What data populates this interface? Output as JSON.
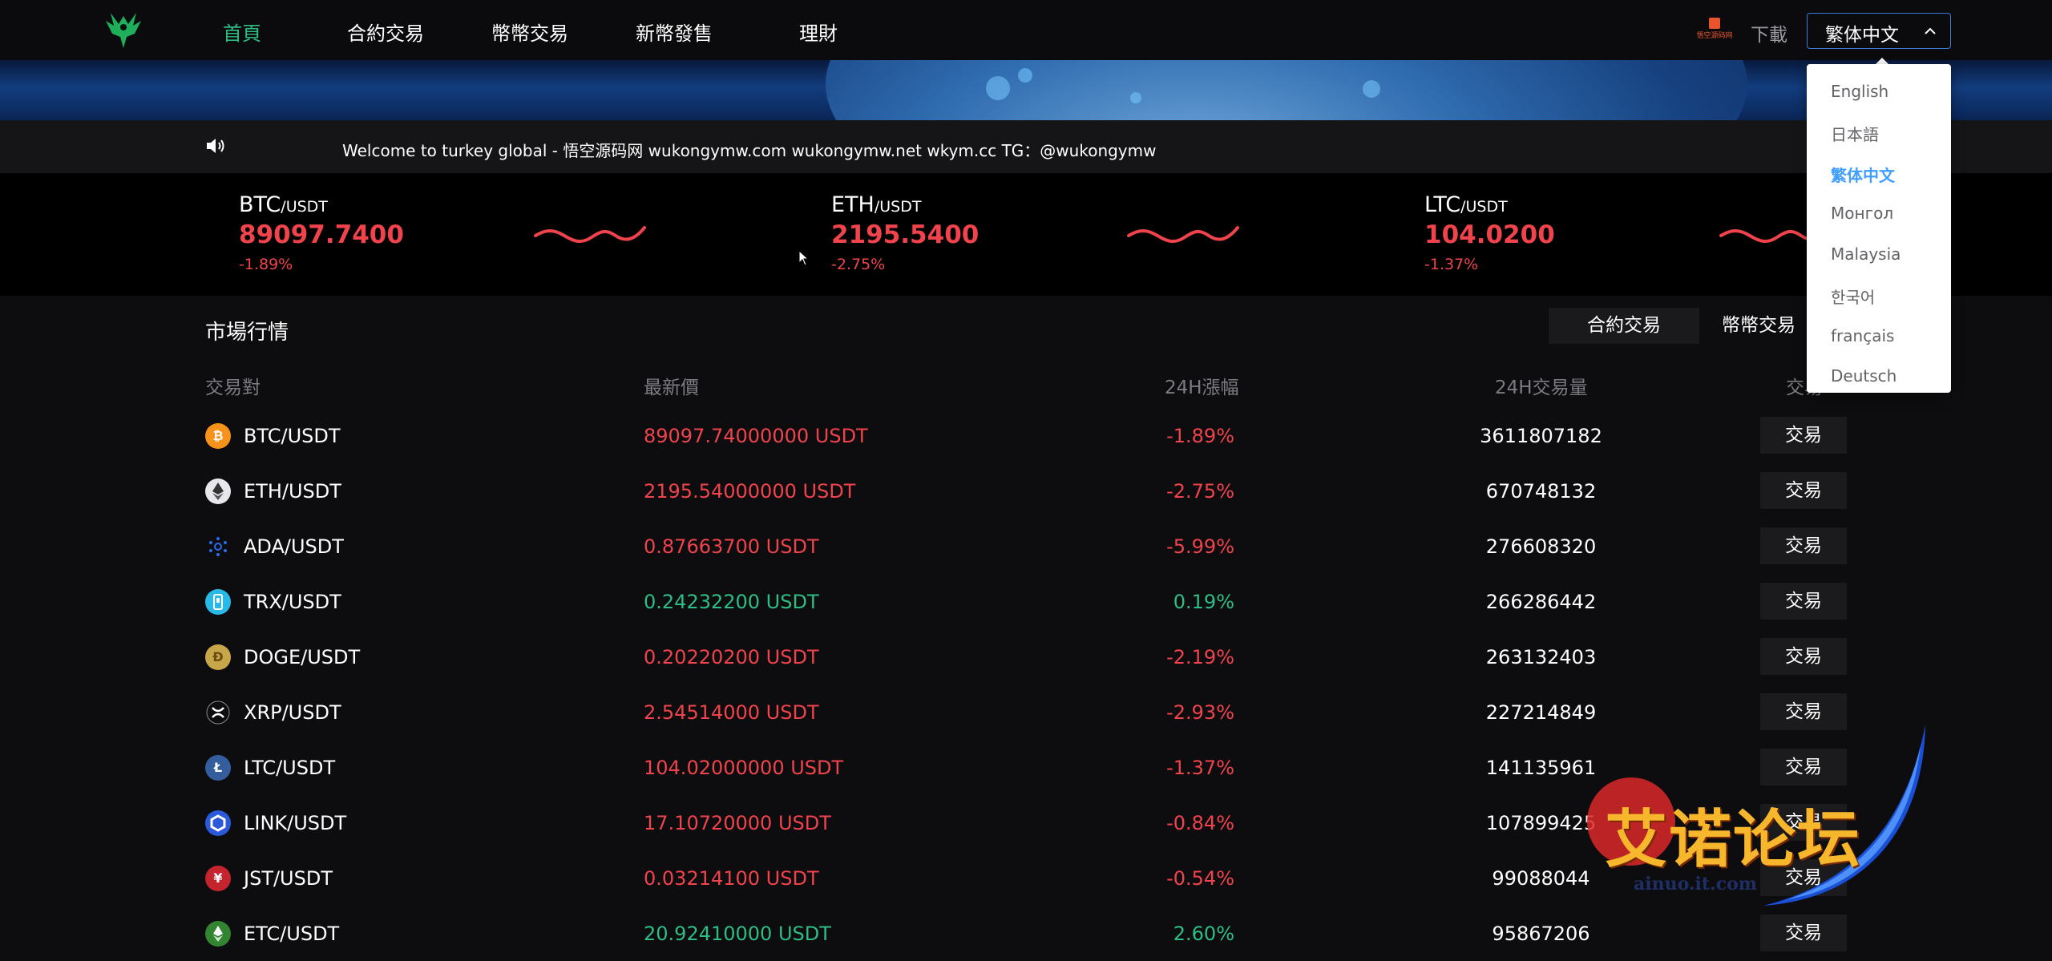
{
  "nav": {
    "items": [
      {
        "label": "首頁",
        "active": true
      },
      {
        "label": "合約交易",
        "active": false
      },
      {
        "label": "幣幣交易",
        "active": false
      },
      {
        "label": "新幣發售",
        "active": false
      },
      {
        "label": "理財",
        "active": false
      }
    ],
    "partner_logo_text": "悟空源码网",
    "download": "下載",
    "language_selected": "繁体中文"
  },
  "language_dropdown": {
    "options": [
      "English",
      "日本語",
      "繁体中文",
      "Монгол",
      "Malaysia",
      "한국어",
      "français",
      "Deutsch"
    ],
    "selected": "繁体中文"
  },
  "announcement": {
    "text": "Welcome to turkey global - 悟空源码网 wukongymw.com wukongymw.net wkym.cc TG：@wukongymw"
  },
  "tickers": [
    {
      "base": "BTC",
      "quote": "/USDT",
      "price": "89097.7400",
      "change": "-1.89%"
    },
    {
      "base": "ETH",
      "quote": "/USDT",
      "price": "2195.5400",
      "change": "-2.75%"
    },
    {
      "base": "LTC",
      "quote": "/USDT",
      "price": "104.0200",
      "change": "-1.37%"
    }
  ],
  "market": {
    "title": "市場行情",
    "tabs": [
      "合約交易",
      "幣幣交易"
    ],
    "columns": [
      "交易對",
      "最新價",
      "24H漲幅",
      "24H交易量",
      "交易"
    ],
    "rows": [
      {
        "icon": "bitcoin-icon",
        "pair": "BTC/USDT",
        "price": "89097.74000000 USDT",
        "change": "-1.89%",
        "trend": "down",
        "volume": "3611807182",
        "action": "交易"
      },
      {
        "icon": "ethereum-icon",
        "pair": "ETH/USDT",
        "price": "2195.54000000 USDT",
        "change": "-2.75%",
        "trend": "down",
        "volume": "670748132",
        "action": "交易"
      },
      {
        "icon": "cardano-icon",
        "pair": "ADA/USDT",
        "price": "0.87663700 USDT",
        "change": "-5.99%",
        "trend": "down",
        "volume": "276608320",
        "action": "交易"
      },
      {
        "icon": "tron-icon",
        "pair": "TRX/USDT",
        "price": "0.24232200 USDT",
        "change": "0.19%",
        "trend": "up",
        "volume": "266286442",
        "action": "交易"
      },
      {
        "icon": "dogecoin-icon",
        "pair": "DOGE/USDT",
        "price": "0.20220200 USDT",
        "change": "-2.19%",
        "trend": "down",
        "volume": "263132403",
        "action": "交易"
      },
      {
        "icon": "xrp-icon",
        "pair": "XRP/USDT",
        "price": "2.54514000 USDT",
        "change": "-2.93%",
        "trend": "down",
        "volume": "227214849",
        "action": "交易"
      },
      {
        "icon": "litecoin-icon",
        "pair": "LTC/USDT",
        "price": "104.02000000 USDT",
        "change": "-1.37%",
        "trend": "down",
        "volume": "141135961",
        "action": "交易"
      },
      {
        "icon": "chainlink-icon",
        "pair": "LINK/USDT",
        "price": "17.10720000 USDT",
        "change": "-0.84%",
        "trend": "down",
        "volume": "107899425",
        "action": "交易"
      },
      {
        "icon": "just-icon",
        "pair": "JST/USDT",
        "price": "0.03214100 USDT",
        "change": "-0.54%",
        "trend": "down",
        "volume": "99088044",
        "action": "交易"
      },
      {
        "icon": "ethereum-classic-icon",
        "pair": "ETC/USDT",
        "price": "20.92410000 USDT",
        "change": "2.60%",
        "trend": "up",
        "volume": "95867206",
        "action": "交易"
      }
    ]
  },
  "watermark": {
    "text": "艾诺论坛",
    "url": "ainuo.it.com"
  },
  "colors": {
    "up": "#2ebd85",
    "down": "#f0434b",
    "accent": "#409eff"
  }
}
